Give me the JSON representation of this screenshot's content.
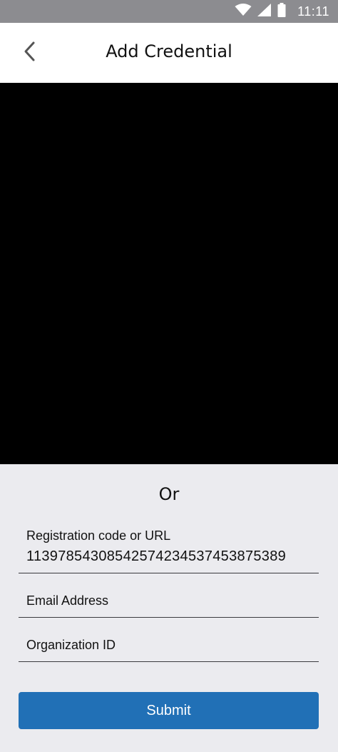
{
  "status_bar": {
    "time": "11:11",
    "icons": [
      "wifi-icon",
      "signal-icon",
      "battery-icon"
    ]
  },
  "app_bar": {
    "title": "Add Credential",
    "back_icon": "chevron-left-icon"
  },
  "form": {
    "or_label": "Or",
    "registration": {
      "label": "Registration code or URL",
      "value": "1139785430854257423453745387538​9"
    },
    "email": {
      "label": "Email Address",
      "value": ""
    },
    "organization": {
      "label": "Organization ID",
      "value": ""
    },
    "submit_label": "Submit"
  },
  "colors": {
    "status_bar": "#8c8c90",
    "app_bar": "#ffffff",
    "camera": "#000000",
    "form_bg": "#ebebef",
    "primary": "#2170b6"
  }
}
